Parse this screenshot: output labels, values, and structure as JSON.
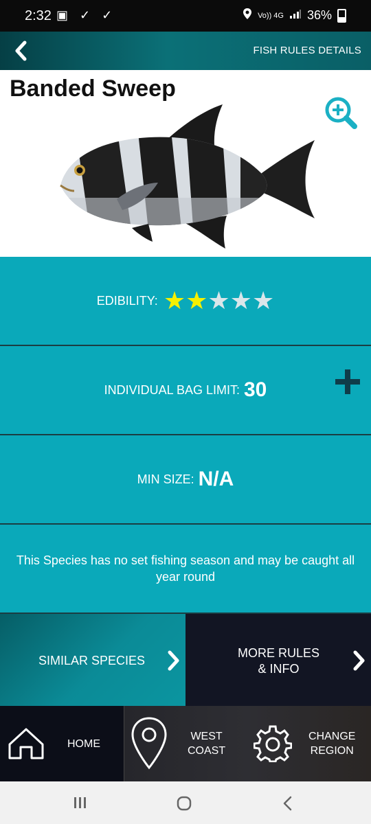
{
  "status": {
    "time": "2:32",
    "left_icons": "▣ ✓ ✓",
    "network": "Vo)) 4G",
    "battery": "36%"
  },
  "header": {
    "title": "FISH RULES DETAILS"
  },
  "fish": {
    "name": "Banded Sweep"
  },
  "edibility": {
    "label": "EDIBILITY:",
    "rating": 2,
    "max": 5,
    "filled_color": "#f5f000",
    "empty_color": "#d9e6ea"
  },
  "bag_limit": {
    "label": "INDIVIDUAL BAG LIMIT:",
    "value": "30"
  },
  "min_size": {
    "label": "MIN SIZE:",
    "value": "N/A"
  },
  "season": {
    "text": "This Species has no set fishing season and may be caught all year round"
  },
  "actions": {
    "similar_label": "SIMILAR SPECIES",
    "more_label_line1": "MORE RULES",
    "more_label_line2": "& INFO"
  },
  "nav": {
    "home_label": "HOME",
    "region_line1": "WEST",
    "region_line2": "COAST",
    "change_line1": "CHANGE",
    "change_line2": "REGION"
  },
  "colors": {
    "accent": "#0aa9ba",
    "header": "#0b7077",
    "dark": "#121523"
  }
}
